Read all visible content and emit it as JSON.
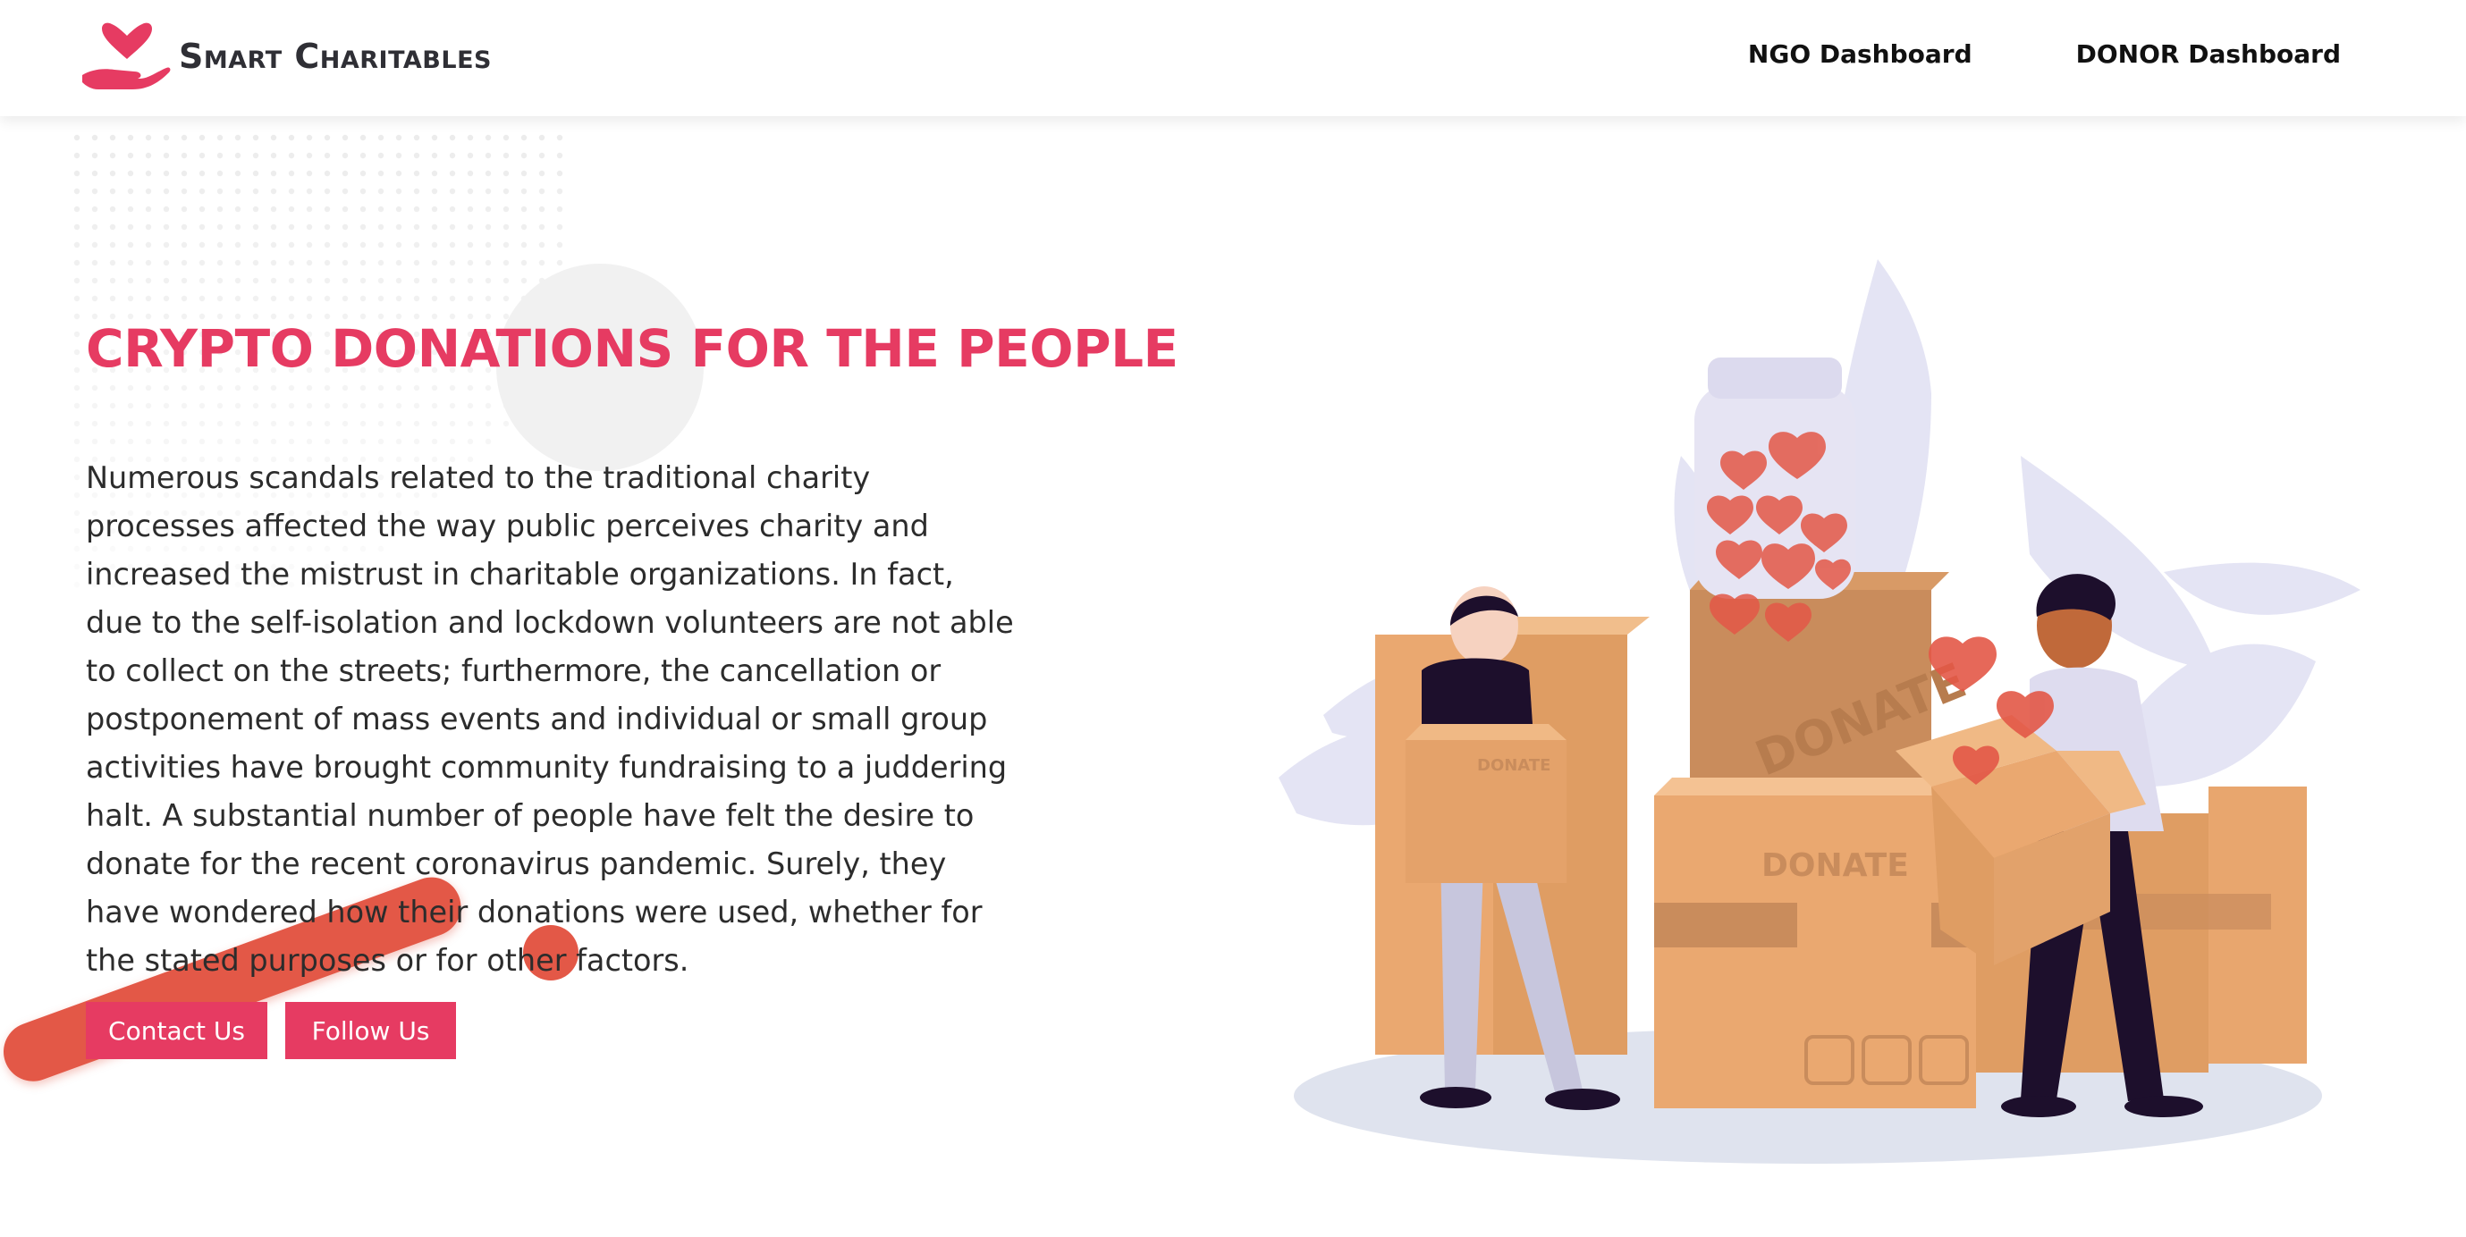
{
  "header": {
    "brand_name": "Smart Charitables",
    "nav": [
      {
        "label": "NGO Dashboard"
      },
      {
        "label": "DONOR Dashboard"
      }
    ]
  },
  "hero": {
    "title": "CRYPTO DONATIONS FOR THE PEOPLE",
    "description": "Numerous scandals related to the traditional charity processes affected the way public perceives charity and increased the mistrust in charitable organizations. In fact, due to the self-isolation and lockdown volunteers are not able to collect on the streets; furthermore, the cancellation or postponement of mass events and individual or small group activities have brought community fundraising to a juddering halt. A substantial number of people have felt the desire to donate for the recent coronavirus pandemic. Surely, they have wondered how their donations were used, whether for the stated purposes or for other factors.",
    "buttons": {
      "contact": "Contact Us",
      "follow": "Follow Us"
    }
  },
  "illustration": {
    "box_label": "DONATE"
  },
  "colors": {
    "accent": "#e63b62",
    "decor_red": "#e35847",
    "box": "#eaa870",
    "leaf": "#e4e4f4"
  },
  "icons": [
    "logo-heart-hand-icon"
  ]
}
